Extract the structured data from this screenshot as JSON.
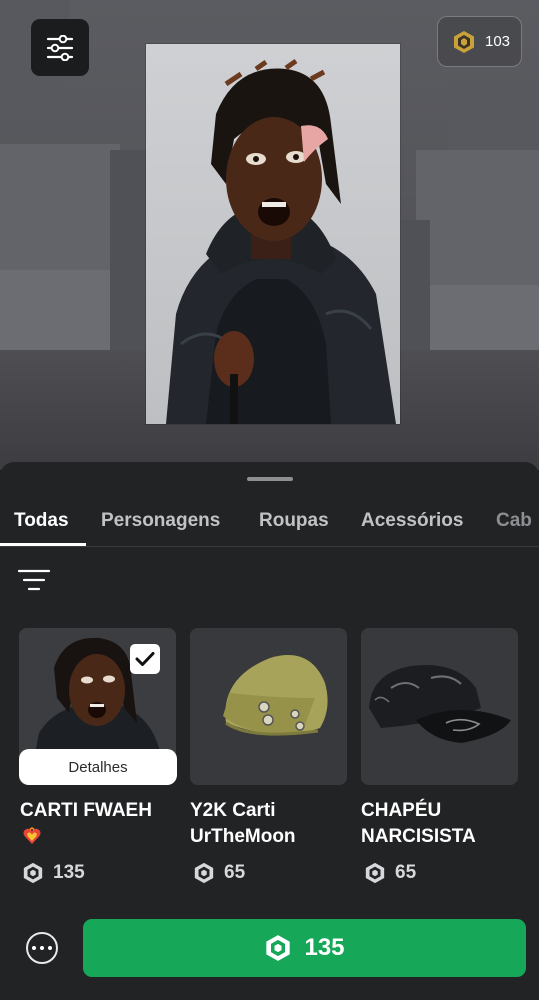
{
  "header": {
    "menu_icon": "sliders-icon",
    "balance": {
      "icon": "robux-coin-icon",
      "value": "103",
      "icon_color": "#c9a13b"
    }
  },
  "sheet": {
    "tabs": [
      {
        "label": "Todas",
        "active": true
      },
      {
        "label": "Personagens",
        "active": false
      },
      {
        "label": "Roupas",
        "active": false
      },
      {
        "label": "Acessórios",
        "active": false
      },
      {
        "label": "Cab",
        "active": false
      }
    ],
    "filter_icon": "sort-filter-icon",
    "items": [
      {
        "title_lines": [
          "CARTI FWAEH"
        ],
        "badge_icon": "fire-heart-emoji-icon",
        "price": "135",
        "selected": true,
        "details_label": "Detalhes",
        "thumb": "character-portrait"
      },
      {
        "title_lines": [
          "Y2K Carti",
          "UrTheMoon"
        ],
        "price": "65",
        "selected": false,
        "thumb": "beanie-hat"
      },
      {
        "title_lines": [
          "CHAPÉU",
          "NARCISISTA"
        ],
        "price": "65",
        "selected": false,
        "thumb": "black-cap"
      }
    ]
  },
  "footer": {
    "more_icon": "more-options-icon",
    "buy_price": "135",
    "buy_color": "#16a758"
  }
}
